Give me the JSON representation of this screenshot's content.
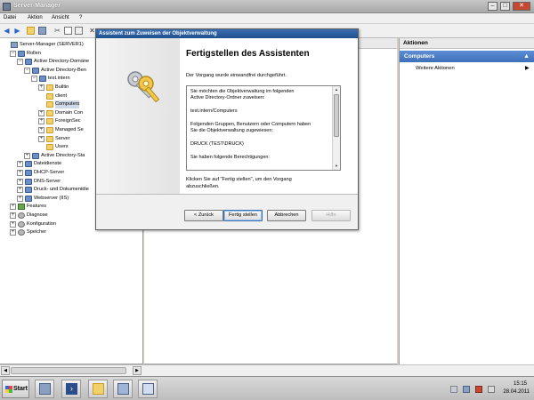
{
  "window": {
    "title": "Server-Manager",
    "min_glyph": "–",
    "max_glyph": "□",
    "close_glyph": "✕"
  },
  "menu": [
    "Datei",
    "Aktion",
    "Ansicht",
    "?"
  ],
  "tree": {
    "rows": [
      {
        "label": "Server-Manager (SERVER1)",
        "depth": 0,
        "expander": "",
        "icon": "server"
      },
      {
        "label": "Rollen",
        "depth": 1,
        "expander": "−",
        "icon": "role"
      },
      {
        "label": "Active Directory-Domäne",
        "depth": 2,
        "expander": "−",
        "icon": "role"
      },
      {
        "label": "Active Directory-Ben",
        "depth": 3,
        "expander": "−",
        "icon": "role"
      },
      {
        "label": "test.intern",
        "depth": 4,
        "expander": "−",
        "icon": "role"
      },
      {
        "label": "Builtin",
        "depth": 5,
        "expander": "+",
        "icon": "folder"
      },
      {
        "label": "client",
        "depth": 5,
        "expander": "",
        "icon": "folder"
      },
      {
        "label": "Computers",
        "depth": 5,
        "expander": "",
        "icon": "folder",
        "selected": true
      },
      {
        "label": "Domain Con",
        "depth": 5,
        "expander": "+",
        "icon": "folder"
      },
      {
        "label": "ForeignSec",
        "depth": 5,
        "expander": "+",
        "icon": "folder"
      },
      {
        "label": "Managed Se",
        "depth": 5,
        "expander": "+",
        "icon": "folder"
      },
      {
        "label": "Server",
        "depth": 5,
        "expander": "+",
        "icon": "folder"
      },
      {
        "label": "Users",
        "depth": 5,
        "expander": "",
        "icon": "folder"
      },
      {
        "label": "Active Directory-Sta",
        "depth": 3,
        "expander": "+",
        "icon": "role"
      },
      {
        "label": "Dateidienste",
        "depth": 2,
        "expander": "+",
        "icon": "role"
      },
      {
        "label": "DHCP-Server",
        "depth": 2,
        "expander": "+",
        "icon": "role"
      },
      {
        "label": "DNS-Server",
        "depth": 2,
        "expander": "+",
        "icon": "role"
      },
      {
        "label": "Druck- und Dokumentdie",
        "depth": 2,
        "expander": "+",
        "icon": "role"
      },
      {
        "label": "Webserver (IIS)",
        "depth": 2,
        "expander": "+",
        "icon": "role"
      },
      {
        "label": "Features",
        "depth": 1,
        "expander": "+",
        "icon": "green"
      },
      {
        "label": "Diagnose",
        "depth": 1,
        "expander": "+",
        "icon": "gear"
      },
      {
        "label": "Konfiguration",
        "depth": 1,
        "expander": "+",
        "icon": "gear"
      },
      {
        "label": "Speicher",
        "depth": 1,
        "expander": "+",
        "icon": "gear"
      }
    ]
  },
  "actions": {
    "header": "Aktionen",
    "section": "Computers",
    "section_arrow": "▲",
    "item": "Weitere Aktionen",
    "item_arrow": "▶"
  },
  "wizard": {
    "title": "Assistent zum Zuweisen der Objektverwaltung",
    "heading": "Fertigstellen des Assistenten",
    "intro": "Der Vorgang wurde einwandfrei durchgeführt.",
    "summary_lines": [
      "Sie möchten die Objektverwaltung im folgenden",
      "Active Directory-Ordner zuweisen:",
      "",
      "test.intern/Computers",
      "",
      "Folgenden Gruppen, Benutzern oder Computern haben",
      "Sie die Objektverwaltung zugewiesen:",
      "",
      "DRUCK (TEST\\DRUCK)",
      "",
      "Sie haben folgende Berechtigungen:"
    ],
    "finish_hint_1": "Klicken Sie auf \"Fertig stellen\", um den Vorgang",
    "finish_hint_2": "abzuschließen.",
    "buttons": {
      "back": "< Zurück",
      "finish": "Fertig stellen",
      "cancel": "Abbrechen",
      "help": "Hilfe"
    }
  },
  "taskbar": {
    "start": "Start",
    "time": "15:15",
    "date": "28.04.2011"
  }
}
